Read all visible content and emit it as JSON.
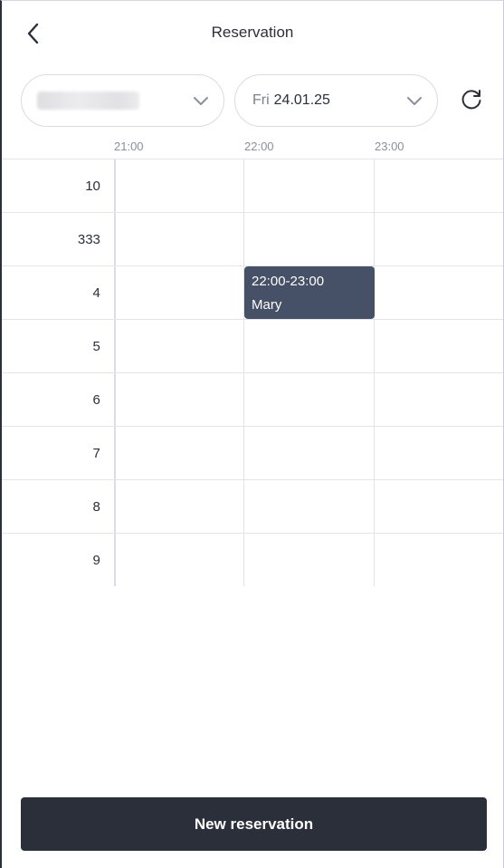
{
  "header": {
    "title": "Reservation"
  },
  "filters": {
    "date": {
      "day": "Fri",
      "value": "24.01.25"
    }
  },
  "timeline": {
    "hours": [
      "21:00",
      "22:00",
      "23:00"
    ],
    "rows": [
      "10",
      "333",
      "4",
      "5",
      "6",
      "7",
      "8",
      "9"
    ]
  },
  "reservations": [
    {
      "row": "4",
      "time": "22:00-23:00",
      "name": "Mary"
    }
  ],
  "actions": {
    "new_reservation": "New reservation"
  },
  "icons": {
    "back": "chevron-left-icon",
    "dropdown": "chevron-down-icon",
    "refresh": "refresh-icon"
  },
  "colors": {
    "primary_dark": "#2b2f3a",
    "event_bg": "#465066",
    "muted_text": "#8a8f9c"
  }
}
